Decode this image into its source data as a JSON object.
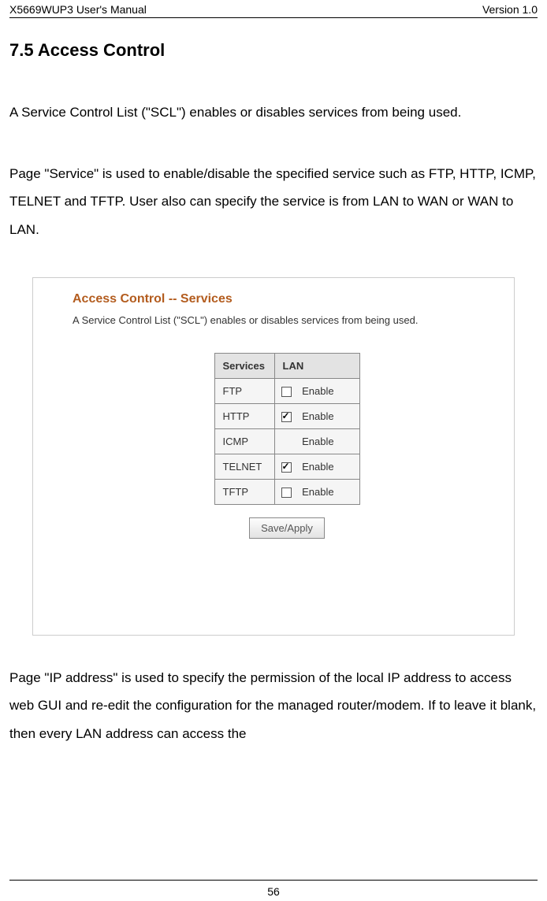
{
  "header": {
    "left": "X5669WUP3 User's Manual",
    "right": "Version 1.0"
  },
  "heading": "7.5 Access Control",
  "para1": "A Service Control List (\"SCL\") enables or disables services from being used.",
  "para2": "Page \"Service\" is used to enable/disable the specified service such as FTP, HTTP, ICMP, TELNET and TFTP. User also can specify the service is from LAN to WAN or WAN to LAN.",
  "screenshot": {
    "title": "Access Control -- Services",
    "desc": "A Service Control List (\"SCL\") enables or disables services from being used.",
    "columns": {
      "services": "Services",
      "lan": "LAN"
    },
    "rows": [
      {
        "name": "FTP",
        "checkbox": "unchecked",
        "label": "Enable"
      },
      {
        "name": "HTTP",
        "checkbox": "checked",
        "label": "Enable"
      },
      {
        "name": "ICMP",
        "checkbox": "none",
        "label": "Enable"
      },
      {
        "name": "TELNET",
        "checkbox": "checked",
        "label": "Enable"
      },
      {
        "name": "TFTP",
        "checkbox": "unchecked",
        "label": "Enable"
      }
    ],
    "button": "Save/Apply"
  },
  "para3": "Page \"IP address\" is used to specify the permission of the local IP address to access web GUI and re-edit the configuration for the managed router/modem. If to leave it blank, then every LAN address can access the",
  "page_number": "56"
}
